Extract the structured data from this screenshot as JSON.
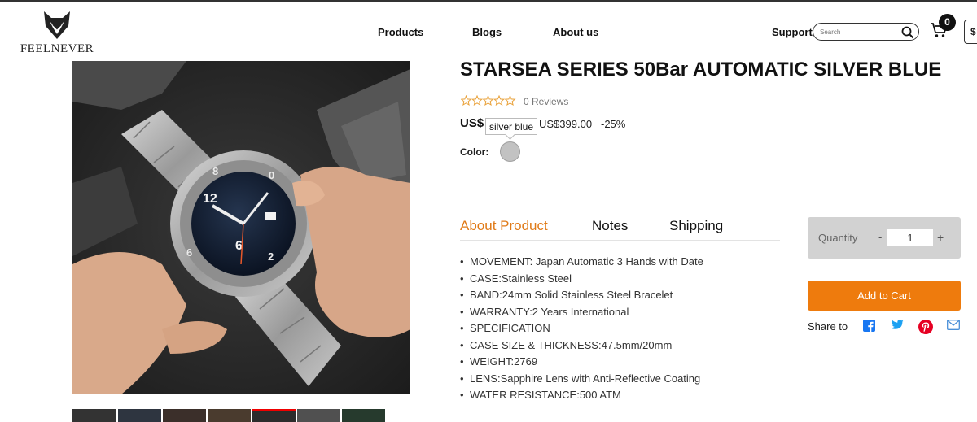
{
  "header": {
    "logo_text": "FEELNEVER",
    "nav": [
      "Products",
      "Blogs",
      "About us"
    ],
    "support_label": "Support",
    "search_placeholder": "Search",
    "cart_count": "0",
    "edge_box_text": "$"
  },
  "product": {
    "title": "STARSEA SERIES 50Bar AUTOMATIC SILVER BLUE",
    "rating_stars": 0,
    "reviews": "0 Reviews",
    "price_currency": "US$",
    "original_price": "US$399.00",
    "discount": "-25%",
    "color_label": "Color:",
    "color_tooltip": "silver blue",
    "swatch_color": "#c2c2c2"
  },
  "tabs": [
    {
      "label": "About Product",
      "active": true
    },
    {
      "label": "Notes",
      "active": false
    },
    {
      "label": "Shipping",
      "active": false
    }
  ],
  "specs": [
    "MOVEMENT: Japan Automatic 3 Hands with Date",
    "CASE:Stainless Steel",
    "BAND:24mm Solid Stainless Steel Bracelet",
    "WARRANTY:2 Years International",
    "SPECIFICATION",
    "CASE SIZE & THICKNESS:47.5mm/20mm",
    "WEIGHT:2769",
    "LENS:Sapphire Lens with Anti-Reflective Coating",
    "WATER RESISTANCE:500 ATM"
  ],
  "purchase": {
    "quantity_label": "Quantity",
    "minus": "-",
    "quantity_value": "1",
    "plus": "+",
    "add_to_cart": "Add to Cart",
    "share_label": "Share to"
  },
  "colors": {
    "accent": "#ee7b0d",
    "active_tab": "#e07a17",
    "facebook": "#1877f2",
    "twitter": "#1da1f2",
    "pinterest": "#e60023",
    "email": "#4a90d9"
  }
}
